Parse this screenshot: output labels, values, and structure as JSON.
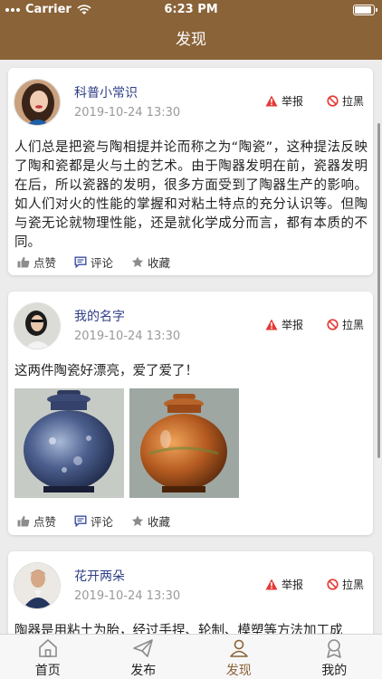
{
  "status_bar": {
    "carrier": "Carrier",
    "time": "6:23 PM"
  },
  "nav": {
    "title": "发现"
  },
  "posts": [
    {
      "username": "科普小常识",
      "timestamp": "2019-10-24 13:30",
      "report_label": "举报",
      "block_label": "拉黑",
      "text": "人们总是把瓷与陶相提并论而称之为“陶瓷”，这种提法反映了陶和瓷都是火与土的艺术。由于陶器发明在前，瓷器发明在后，所以瓷器的发明，很多方面受到了陶器生产的影响。如人们对火的性能的掌握和对粘土特点的充分认识等。但陶与瓷无论就物理性能，还是就化学成分而言，都有本质的不同。",
      "like_label": "点赞",
      "comment_label": "评论",
      "favorite_label": "收藏"
    },
    {
      "username": "我的名字",
      "timestamp": "2019-10-24 13:30",
      "report_label": "举报",
      "block_label": "拉黑",
      "text": "这两件陶瓷好漂亮，爱了爱了！",
      "like_label": "点赞",
      "comment_label": "评论",
      "favorite_label": "收藏"
    },
    {
      "username": "花开两朵",
      "timestamp": "2019-10-24 13:30",
      "report_label": "举报",
      "block_label": "拉黑",
      "text": "陶器是用粘土为胎，经过手捏、轮制、模塑等方法加工成"
    }
  ],
  "tabbar": {
    "items": [
      {
        "label": "首页",
        "icon": "home-icon"
      },
      {
        "label": "发布",
        "icon": "send-icon"
      },
      {
        "label": "发现",
        "icon": "discover-icon",
        "active": true
      },
      {
        "label": "我的",
        "icon": "profile-icon"
      }
    ]
  },
  "colors": {
    "brand": "#8a6338",
    "username": "#2f3f87",
    "report": "#e53935",
    "block": "#e53935",
    "comment_icon": "#3d4fa0"
  }
}
